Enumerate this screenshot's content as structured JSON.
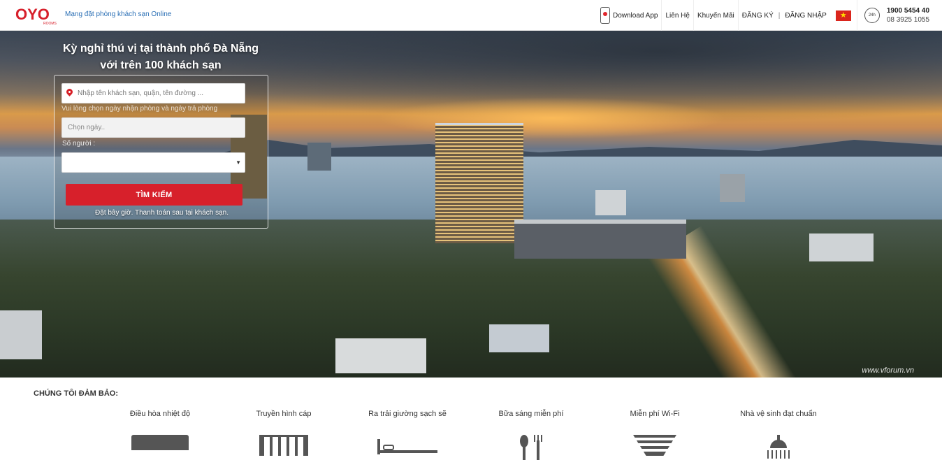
{
  "header": {
    "brand_name": "OYO ROOMS",
    "tagline": "Mạng đặt phòng khách sạn Online",
    "nav": {
      "download_app": "Download App",
      "contact": "Liên Hệ",
      "promotions": "Khuyến Mãi",
      "register": "ĐĂNG KÝ",
      "separator": "|",
      "login": "ĐĂNG NHẬP"
    },
    "support": {
      "badge": "24h",
      "hotline": "1900 5454 40",
      "phone": "08 3925 1055"
    }
  },
  "hero": {
    "title_line1": "Kỳ nghỉ thú vị tại thành phố Đà Nẵng",
    "title_line2": "với trên 100 khách sạn",
    "watermark": "www.vforum.vn"
  },
  "search": {
    "location_placeholder": "Nhập tên khách sạn, quận, tên đường ...",
    "date_hint": "Vui lòng chọn ngày nhận phòng và ngày trả phòng",
    "date_placeholder": "Chọn ngày..",
    "guests_label": "Số người :",
    "guests_value": "",
    "submit_label": "TÌM KIẾM",
    "pay_note": "Đặt bây giờ. Thanh toán sau tại khách sạn."
  },
  "guarantees": {
    "title": "CHÚNG TÔI ĐẢM BẢO:",
    "items": [
      {
        "label": "Điều hòa nhiệt độ",
        "icon": "air-conditioner-icon"
      },
      {
        "label": "Truyền hình cáp",
        "icon": "tv-icon"
      },
      {
        "label": "Ra trải giường sạch sẽ",
        "icon": "bed-icon"
      },
      {
        "label": "Bữa sáng miễn phí",
        "icon": "fork-spoon-icon"
      },
      {
        "label": "Miễn phí Wi-Fi",
        "icon": "wifi-icon"
      },
      {
        "label": "Nhà vệ sinh đạt chuẩn",
        "icon": "shower-icon"
      }
    ]
  },
  "colors": {
    "brand_red": "#d7202b",
    "link_blue": "#2a6fb5"
  }
}
